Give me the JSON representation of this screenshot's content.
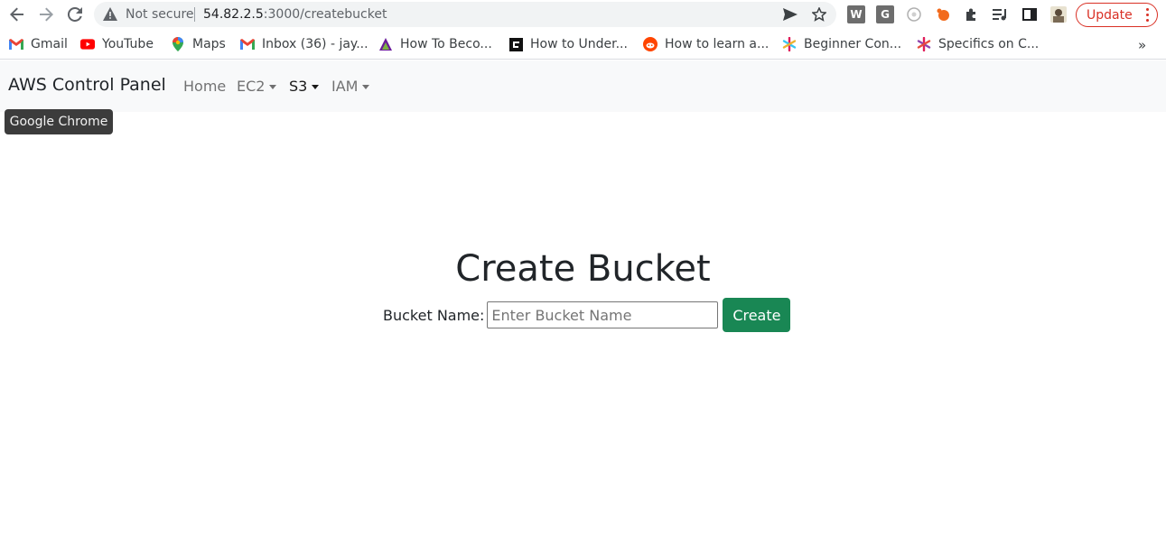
{
  "browser": {
    "security_label": "Not secure",
    "url_host": "54.82.2.5",
    "url_path": ":3000/createbucket",
    "update_label": "Update",
    "extensions": [
      "W",
      "G"
    ],
    "bookmarks": [
      {
        "label": "Gmail",
        "icon": "gmail-icon"
      },
      {
        "label": "YouTube",
        "icon": "youtube-icon"
      },
      {
        "label": "Maps",
        "icon": "maps-icon"
      },
      {
        "label": "Inbox (36) - jay...",
        "icon": "gmail-icon"
      },
      {
        "label": "How To Beco...",
        "icon": "triangle-icon"
      },
      {
        "label": "How to Under...",
        "icon": "square-logo-icon"
      },
      {
        "label": "How to learn a...",
        "icon": "reddit-icon"
      },
      {
        "label": "Beginner Con...",
        "icon": "asterisk-icon"
      },
      {
        "label": "Specifics on C...",
        "icon": "asterisk-icon"
      }
    ],
    "more_bookmarks": "»",
    "tooltip": "Google Chrome"
  },
  "navbar": {
    "brand": "AWS Control Panel",
    "links": [
      {
        "label": "Home",
        "dropdown": false
      },
      {
        "label": "EC2",
        "dropdown": true
      },
      {
        "label": "S3",
        "dropdown": true,
        "active": true
      },
      {
        "label": "IAM",
        "dropdown": true
      }
    ]
  },
  "main": {
    "title": "Create Bucket",
    "bucket_label": "Bucket Name:",
    "bucket_value": "",
    "bucket_placeholder": "Enter Bucket Name",
    "submit_label": "Create"
  },
  "colors": {
    "accent": "#198754",
    "navbar_bg": "#f8f9fa",
    "update": "#d93025"
  }
}
